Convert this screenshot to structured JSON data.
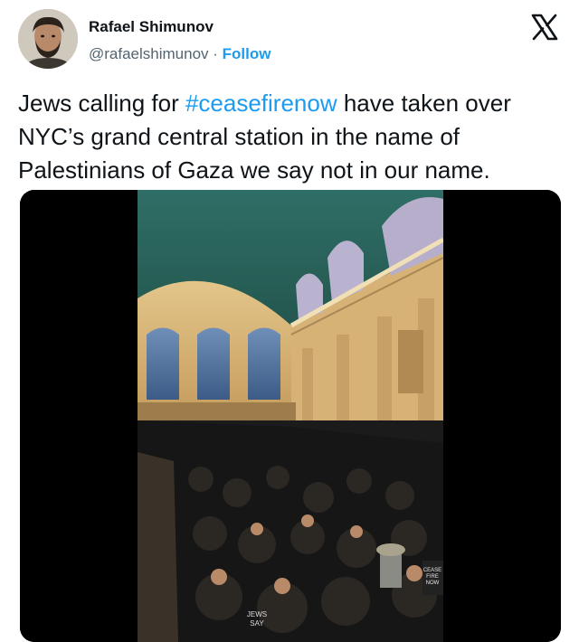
{
  "author": {
    "name": "Rafael Shimunov",
    "handle": "@rafaelshimunov",
    "separator": " · ",
    "follow_label": "Follow"
  },
  "tweet": {
    "text_before": "Jews calling for ",
    "hashtag": "#ceasefirenow",
    "text_after": " have taken over NYC’s grand central station in the name of Palestinians of Gaza we say not in our name."
  },
  "media": {
    "type": "video-still",
    "description_icon": "video-media",
    "sign_text": "CEASE FIRE NOW",
    "shirt_text": "JEWS SAY"
  },
  "icons": {
    "platform_logo": "x-logo-icon"
  },
  "colors": {
    "accent": "#1d9bf0",
    "text": "#0f1419",
    "muted": "#536471"
  }
}
